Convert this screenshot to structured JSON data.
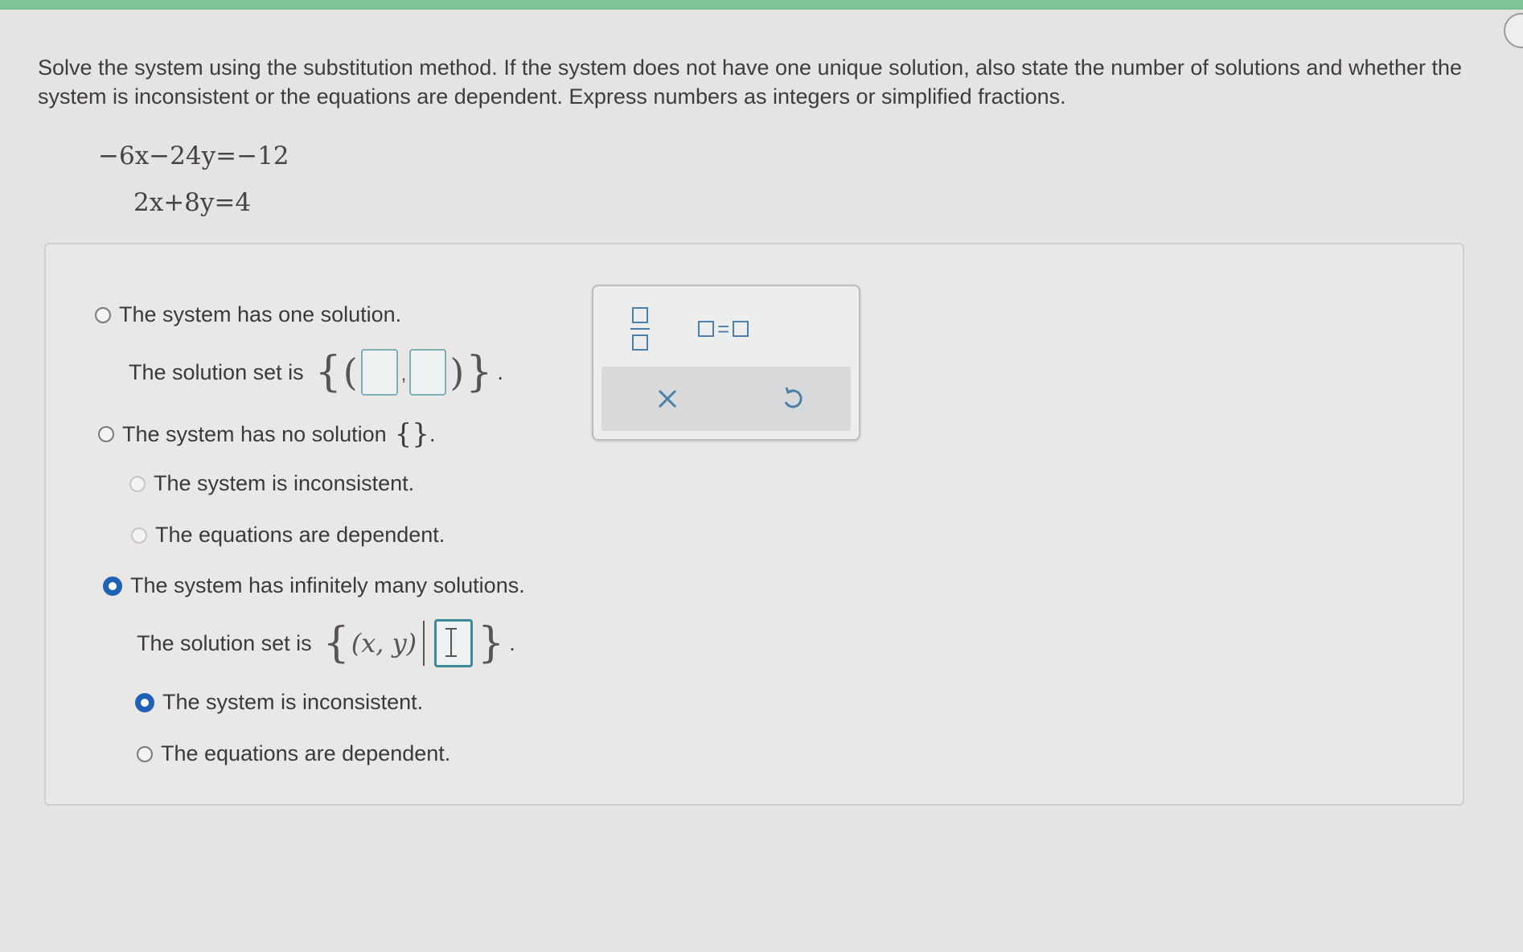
{
  "question": {
    "text": "Solve the system using the substitution method. If the system does not have one unique solution, also state the number of solutions and whether the system is inconsistent or the equations are dependent. Express numbers as integers or simplified fractions."
  },
  "equations": [
    "−6x−24y=−12",
    "2x+8y=4"
  ],
  "options": {
    "one_solution": {
      "label": "The system has one solution.",
      "solution_set_label": "The solution set is",
      "selected": false
    },
    "no_solution": {
      "label": "The system has no solution",
      "empty_set": "{}",
      "suffix": ".",
      "selected": false,
      "sub": {
        "inconsistent": "The system is inconsistent.",
        "dependent": "The equations are dependent."
      }
    },
    "infinite": {
      "label": "The system has infinitely many solutions.",
      "solution_set_label": "The solution set is",
      "set_builder": "(x, y)",
      "selected": true,
      "sub": {
        "inconsistent": "The system is inconsistent.",
        "inconsistent_selected": true,
        "dependent": "The equations are dependent.",
        "dependent_selected": false
      }
    }
  },
  "palette": {
    "eq_sign": "="
  },
  "colors": {
    "top_bar": "#7fc496",
    "radio_selected": "#1f62b5",
    "input_border": "#7fb0b8",
    "palette_icon": "#4d7fa8"
  }
}
